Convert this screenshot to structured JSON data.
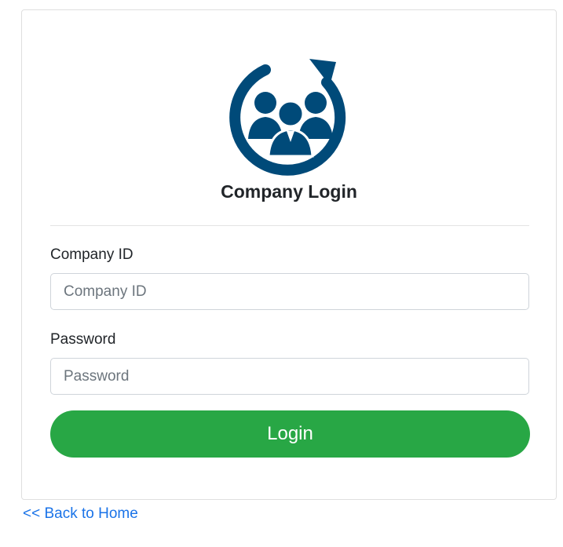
{
  "login": {
    "title": "Company Login",
    "logo_icon": "team-refresh-icon",
    "company_id": {
      "label": "Company ID",
      "placeholder": "Company ID",
      "value": ""
    },
    "password": {
      "label": "Password",
      "placeholder": "Password",
      "value": ""
    },
    "submit_label": "Login"
  },
  "footer": {
    "back_link": "<< Back to Home"
  },
  "colors": {
    "brand": "#004a79",
    "success": "#28a745",
    "link": "#1a73e8"
  }
}
